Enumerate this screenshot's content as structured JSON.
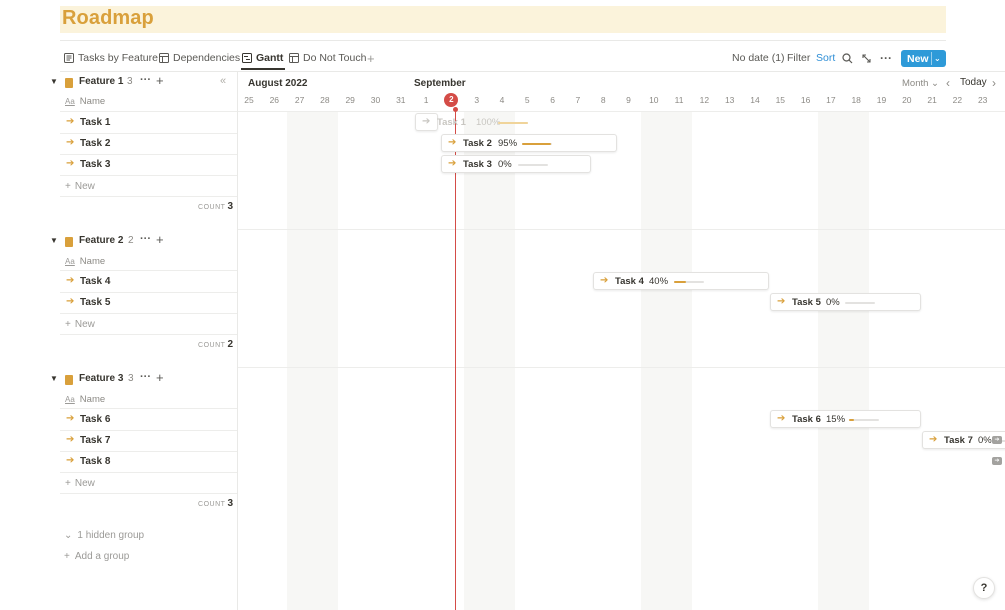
{
  "page": {
    "title": "Roadmap"
  },
  "views": {
    "tabs": [
      "Tasks by Feature",
      "Dependencies",
      "Gantt",
      "Do Not Touch"
    ],
    "add": "+"
  },
  "toolbar": {
    "no_date": "No date (1)",
    "filter": "Filter",
    "sort": "Sort",
    "new": "New"
  },
  "timeline": {
    "month_1": "August 2022",
    "month_2": "September",
    "days": [
      "25",
      "26",
      "27",
      "28",
      "29",
      "30",
      "31",
      "1",
      "2",
      "3",
      "4",
      "5",
      "6",
      "7",
      "8",
      "9",
      "10",
      "11",
      "12",
      "13",
      "14",
      "15",
      "16",
      "17",
      "18",
      "19",
      "20",
      "21",
      "22",
      "23"
    ],
    "today_day": "2",
    "scale": "Month",
    "today": "Today"
  },
  "groups": [
    {
      "name": "Feature 1",
      "count": "3",
      "tasks": [
        "Task 1",
        "Task 2",
        "Task 3"
      ],
      "count_value": "3"
    },
    {
      "name": "Feature 2",
      "count": "2",
      "tasks": [
        "Task 4",
        "Task 5"
      ],
      "count_value": "2"
    },
    {
      "name": "Feature 3",
      "count": "3",
      "tasks": [
        "Task 6",
        "Task 7",
        "Task 8"
      ],
      "count_value": "3"
    }
  ],
  "labels": {
    "name_col": "Name",
    "aa": "Aa",
    "new_row": "New",
    "count": "COUNT",
    "hidden_group": "1 hidden group",
    "add_group": "Add a group",
    "help": "?"
  },
  "bars": [
    {
      "name": "Task 1",
      "pct": "100%",
      "progress": 1.0
    },
    {
      "name": "Task 2",
      "pct": "95%",
      "progress": 0.95
    },
    {
      "name": "Task 3",
      "pct": "0%",
      "progress": 0
    },
    {
      "name": "Task 4",
      "pct": "40%",
      "progress": 0.4
    },
    {
      "name": "Task 5",
      "pct": "0%",
      "progress": 0
    },
    {
      "name": "Task 6",
      "pct": "15%",
      "progress": 0.15
    },
    {
      "name": "Task 7",
      "pct": "0%",
      "progress": 0
    }
  ],
  "colors": {
    "accent": "#d9a03b",
    "today": "#d44c47",
    "link": "#2f8fd6",
    "new_button": "#2e9ad8"
  }
}
